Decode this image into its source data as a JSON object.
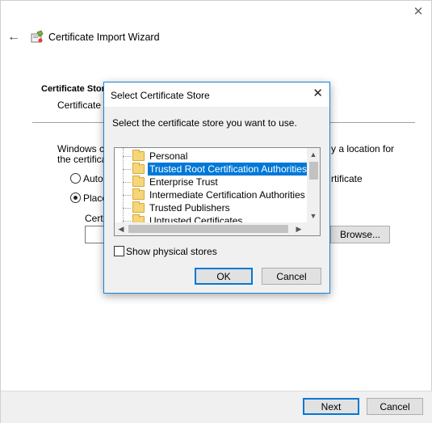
{
  "wizard": {
    "title": "Certificate Import Wizard",
    "close_glyph": "✕",
    "back_glyph": "←",
    "header_title": "Certificate Store",
    "header_subtitle": "Certificate s",
    "body_line1_left": "Windows ca",
    "body_line1_right": "y a location for",
    "body_line2_left": "the certifica",
    "radio_auto_label": "Autor",
    "radio_auto_right": "rtificate",
    "radio_place_label": "Place",
    "store_label": "Certi",
    "browse_label": "Browse...",
    "next_label": "Next",
    "cancel_label": "Cancel"
  },
  "dialog": {
    "title": "Select Certificate Store",
    "close_glyph": "✕",
    "prompt": "Select the certificate store you want to use.",
    "stores": [
      {
        "label": "Personal",
        "selected": false
      },
      {
        "label": "Trusted Root Certification Authorities",
        "selected": true
      },
      {
        "label": "Enterprise Trust",
        "selected": false
      },
      {
        "label": "Intermediate Certification Authorities",
        "selected": false
      },
      {
        "label": "Trusted Publishers",
        "selected": false
      },
      {
        "label": "Untrusted Certificates",
        "selected": false
      }
    ],
    "show_physical_label": "Show physical stores",
    "show_physical_checked": false,
    "ok_label": "OK",
    "cancel_label": "Cancel"
  },
  "icons": {
    "wizard_icon": "certificate-icon",
    "folder_icon": "folder-icon"
  },
  "colors": {
    "accent": "#0078d7",
    "folder": "#f5d67a"
  }
}
